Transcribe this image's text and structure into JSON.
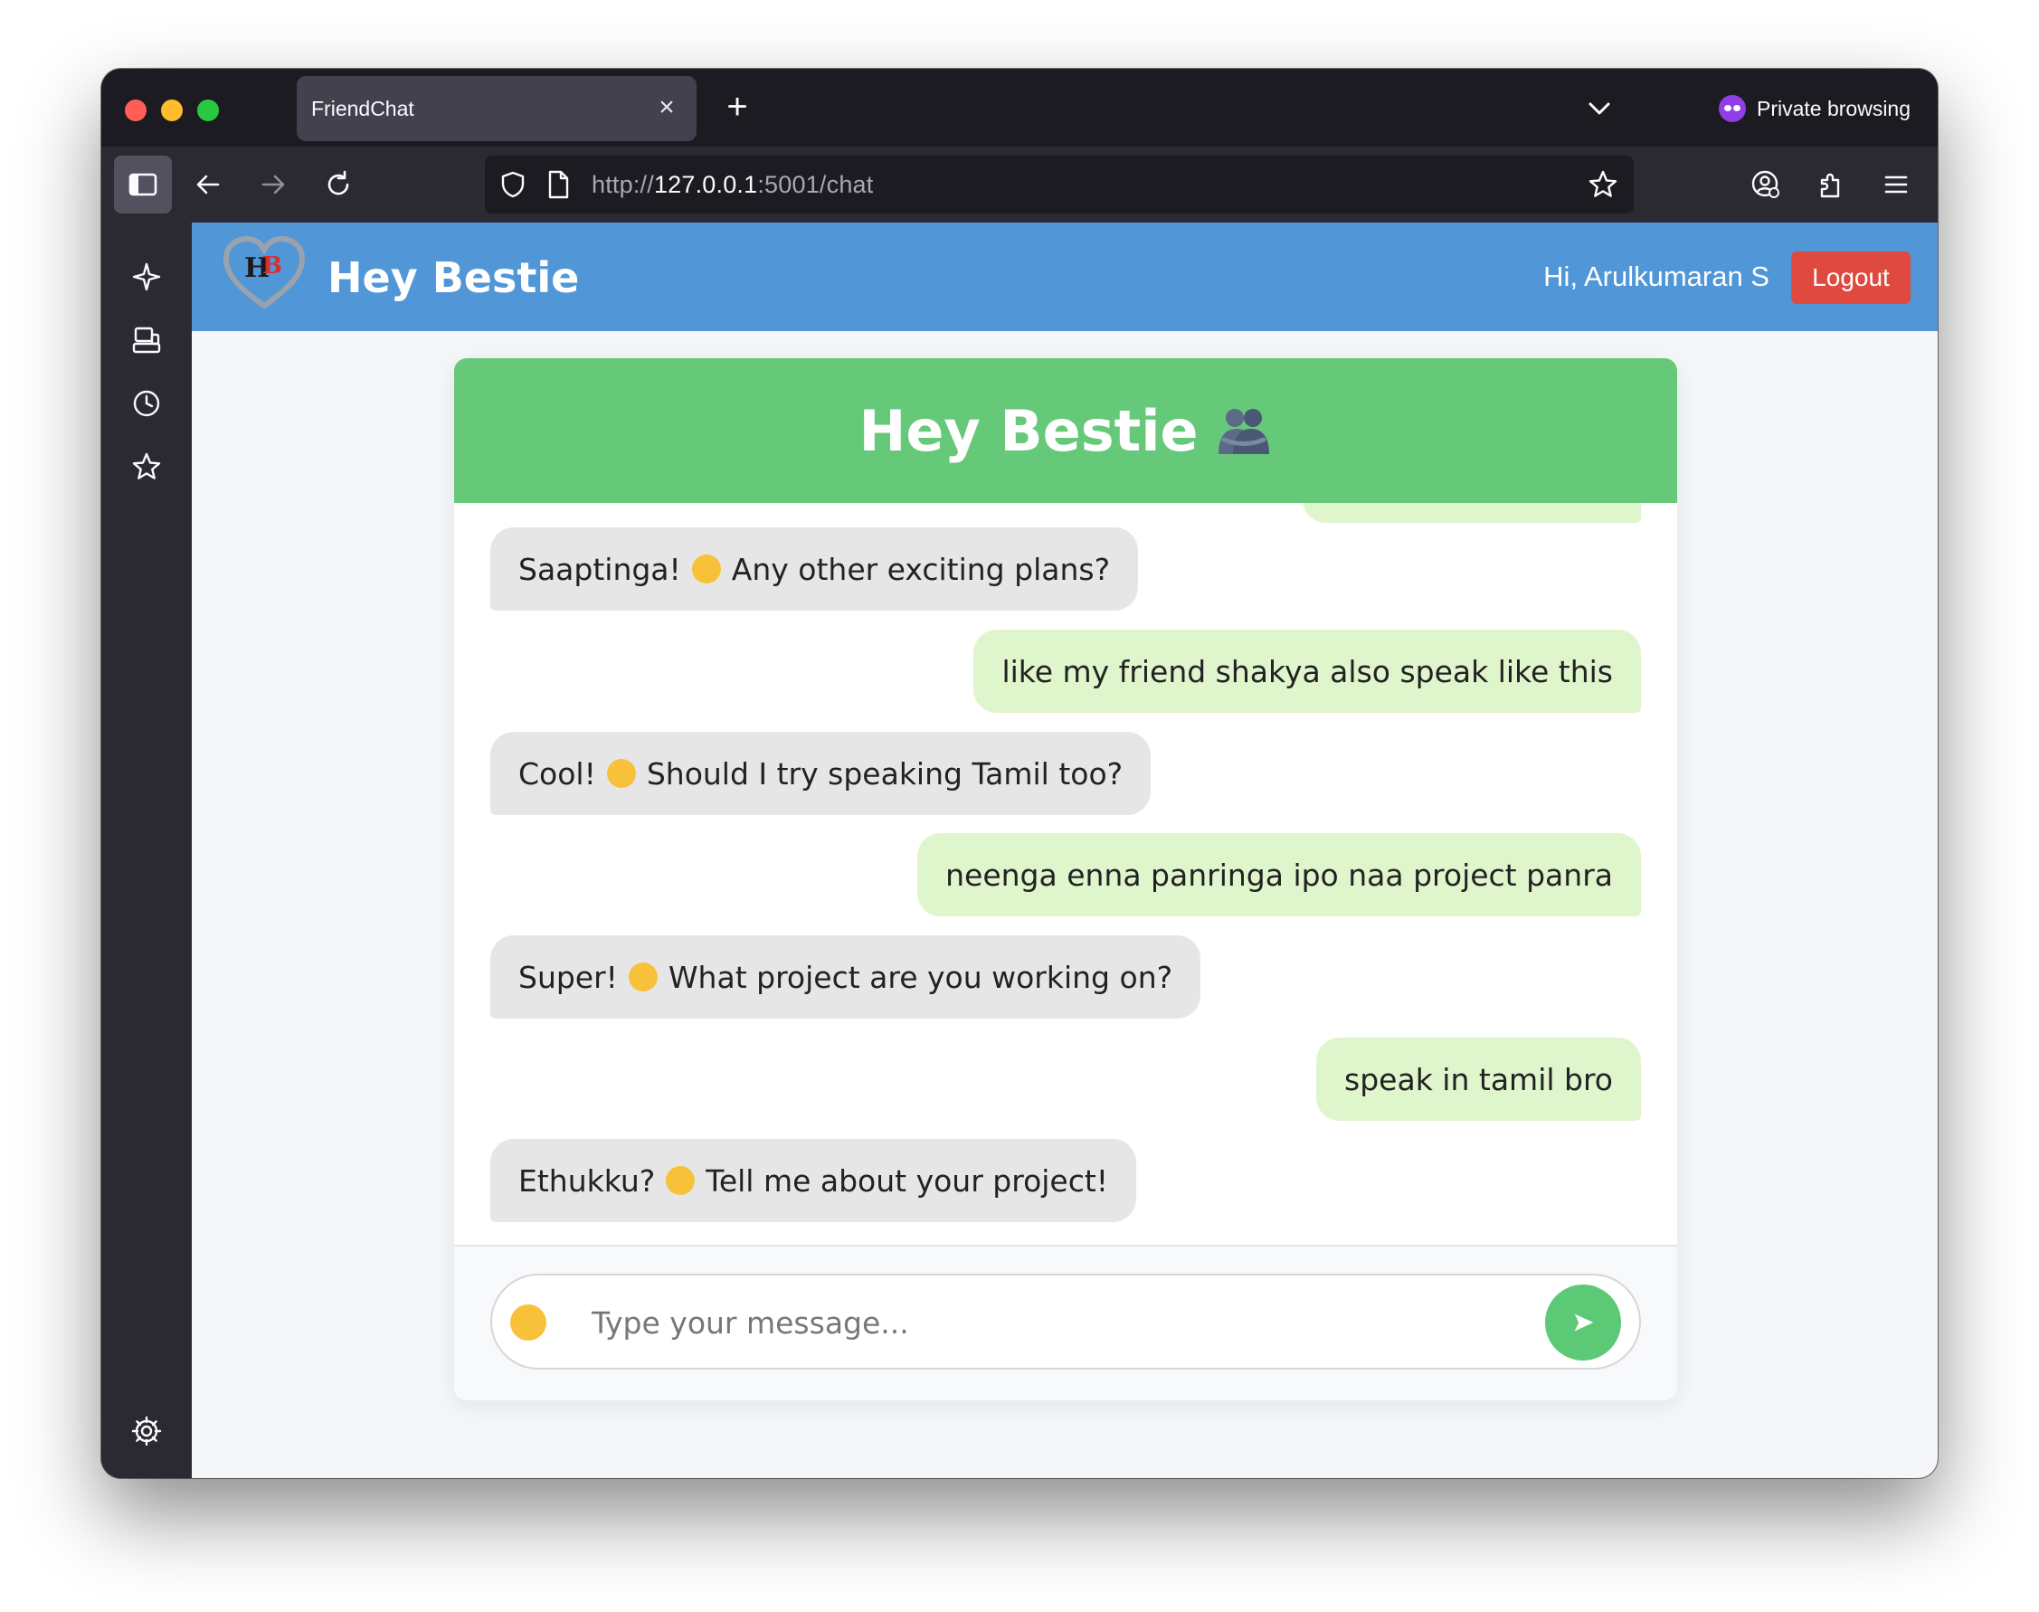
{
  "browser": {
    "tab_title": "FriendChat",
    "private_label": "Private browsing",
    "url_prefix": "http://",
    "url_host": "127.0.0.1",
    "url_rest": ":5001/chat"
  },
  "app": {
    "brand": "Hey Bestie",
    "greeting": "Hi, Arulkumaran S",
    "logout_label": "Logout",
    "accent_color": "#5196d6",
    "chat_header_color": "#66c97a"
  },
  "chat": {
    "title": "Hey Bestie",
    "messages": [
      {
        "sender": "bot",
        "before": "Saaptinga!",
        "emoji": "star-struck",
        "after": "Any other exciting plans?"
      },
      {
        "sender": "user",
        "text": "like my friend shakya also speak like this"
      },
      {
        "sender": "bot",
        "before": "Cool!",
        "emoji": "sunglasses",
        "after": "Should I try speaking Tamil too?"
      },
      {
        "sender": "user",
        "text": "neenga enna panringa ipo naa project panra"
      },
      {
        "sender": "bot",
        "before": "Super!",
        "emoji": "thumbs-up",
        "after": "What project are you working on?"
      },
      {
        "sender": "user",
        "text": "speak in tamil bro"
      },
      {
        "sender": "bot",
        "before": "Ethukku?",
        "emoji": "winking-face",
        "after": "Tell me about your project!"
      }
    ],
    "input_placeholder": "Type your message..."
  }
}
